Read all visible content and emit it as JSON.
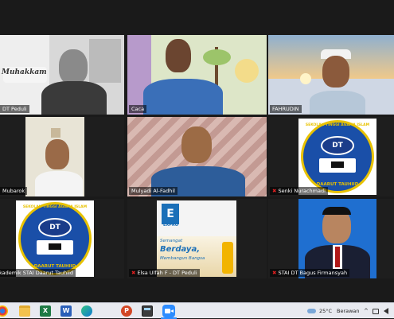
{
  "participants": [
    {
      "name": "DT Peduli",
      "muted": false,
      "banner": "Muhakkam"
    },
    {
      "name": "Caca",
      "muted": false
    },
    {
      "name": "FAHRUDIN",
      "muted": false,
      "active": true
    },
    {
      "name": "Mubarok",
      "muted": false
    },
    {
      "name": "Mulyadi Al-Fadhil",
      "muted": false
    },
    {
      "name": "Senki Nurachmadi",
      "muted": true,
      "logo_text": "SEKOLAH TINGGI AGAMA ISLAM",
      "logo_sub": "DAARUT TAUHIID",
      "logo_center": "DT"
    },
    {
      "name": "akademik STAI Daarut Tauhiid",
      "muted": false,
      "logo_text": "SEKOLAH TINGGI AGAMA ISLAM",
      "logo_sub": "DAARUT TAUHIID",
      "logo_center": "DT"
    },
    {
      "name": "Elsa Ulfah F - DT Peduli",
      "muted": true,
      "poster_brand": "EXPRO",
      "poster_line1": "Semangat",
      "poster_line2": "Berdaya,",
      "poster_line3": "Membangun Bangsa"
    },
    {
      "name": "STAI DT Bagus Firmansyah",
      "muted": true
    }
  ],
  "taskbar": {
    "temperature": "25°C",
    "weather": "Berawan",
    "apps": [
      "chrome-icon",
      "file-explorer-icon",
      "excel-icon",
      "word-icon",
      "edge-icon",
      "powerpoint-icon",
      "calculator-icon",
      "zoom-icon"
    ]
  },
  "colors": {
    "active_outline": "#e6d24a",
    "muted": "#e02020",
    "taskbar": "#e8eaf0"
  }
}
